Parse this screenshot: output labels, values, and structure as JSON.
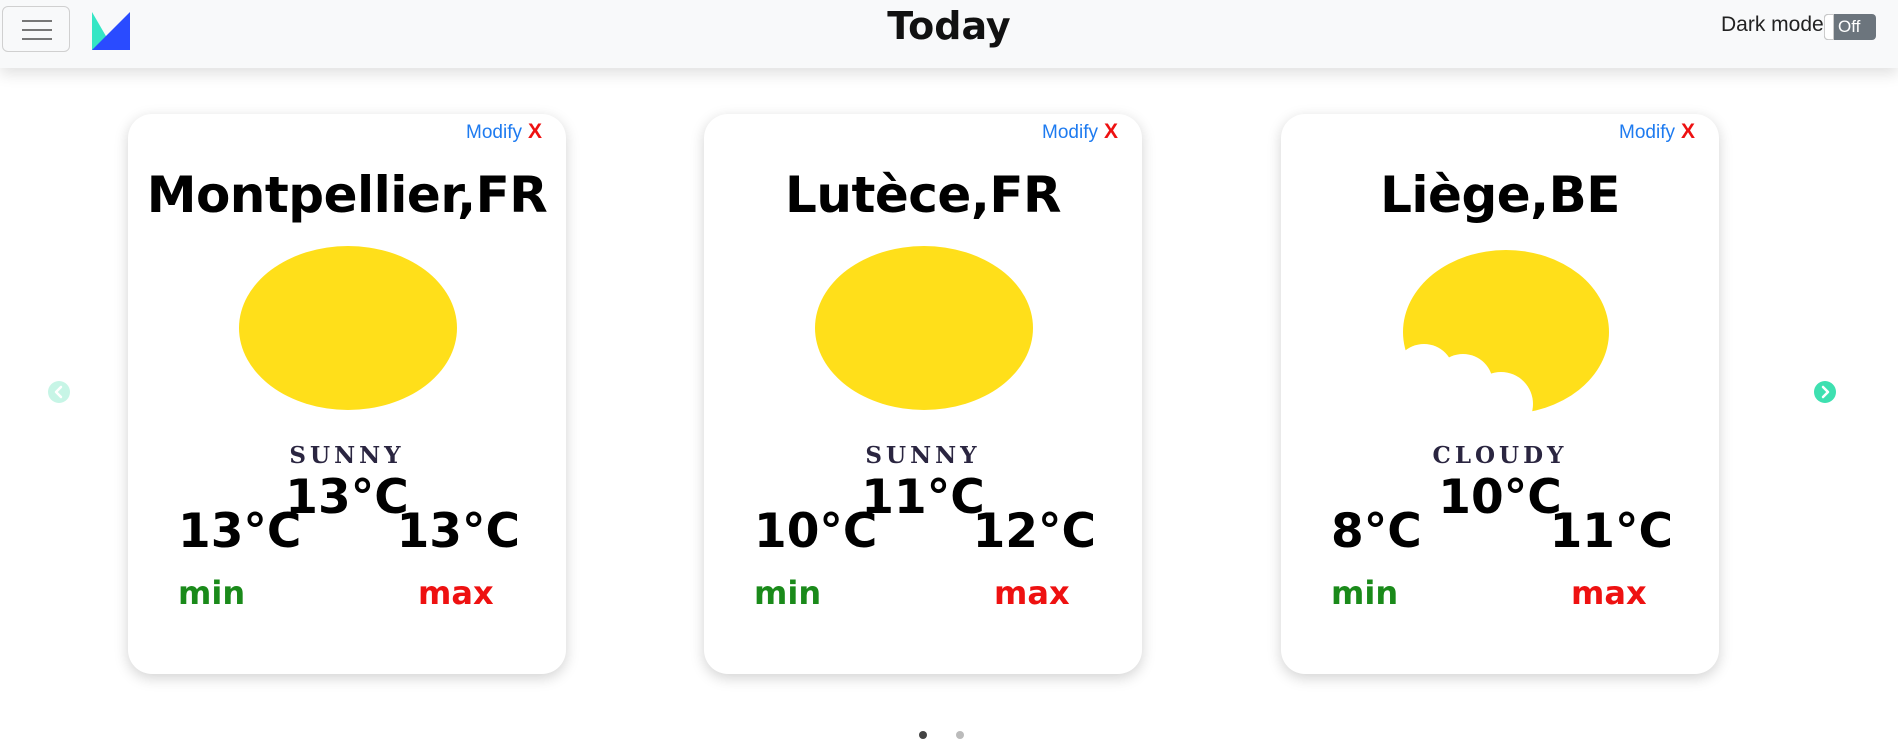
{
  "header": {
    "title": "Today",
    "dark_mode_label": "Dark mode",
    "dark_mode_state": "Off"
  },
  "icons": {
    "menu": "hamburger-icon",
    "logo": "app-logo",
    "prev": "chevron-left-icon",
    "next": "chevron-right-icon",
    "sunny": "sun-icon",
    "cloudy": "sun-behind-cloud-icon"
  },
  "colors": {
    "modify": "#1e7bf0",
    "remove": "#ee1111",
    "min": "#1a8a1a",
    "max": "#ee1111",
    "sun": "#ffdf1a",
    "accent": "#3ee0b0"
  },
  "cards": [
    {
      "modify_label": "Modify",
      "remove_label": "X",
      "city": "Montpellier,FR",
      "condition": "SUNNY",
      "icon": "sun-icon",
      "temp_current": "13°C",
      "temp_min": "13°C",
      "temp_max": "13°C",
      "min_label": "min",
      "max_label": "max"
    },
    {
      "modify_label": "Modify",
      "remove_label": "X",
      "city": "Lutèce,FR",
      "condition": "SUNNY",
      "icon": "sun-icon",
      "temp_current": "11°C",
      "temp_min": "10°C",
      "temp_max": "12°C",
      "min_label": "min",
      "max_label": "max"
    },
    {
      "modify_label": "Modify",
      "remove_label": "X",
      "city": "Liège,BE",
      "condition": "CLOUDY",
      "icon": "sun-behind-cloud-icon",
      "temp_current": "10°C",
      "temp_min": "8°C",
      "temp_max": "11°C",
      "min_label": "min",
      "max_label": "max"
    }
  ],
  "carousel": {
    "page_count": 2,
    "active_page": 1
  }
}
